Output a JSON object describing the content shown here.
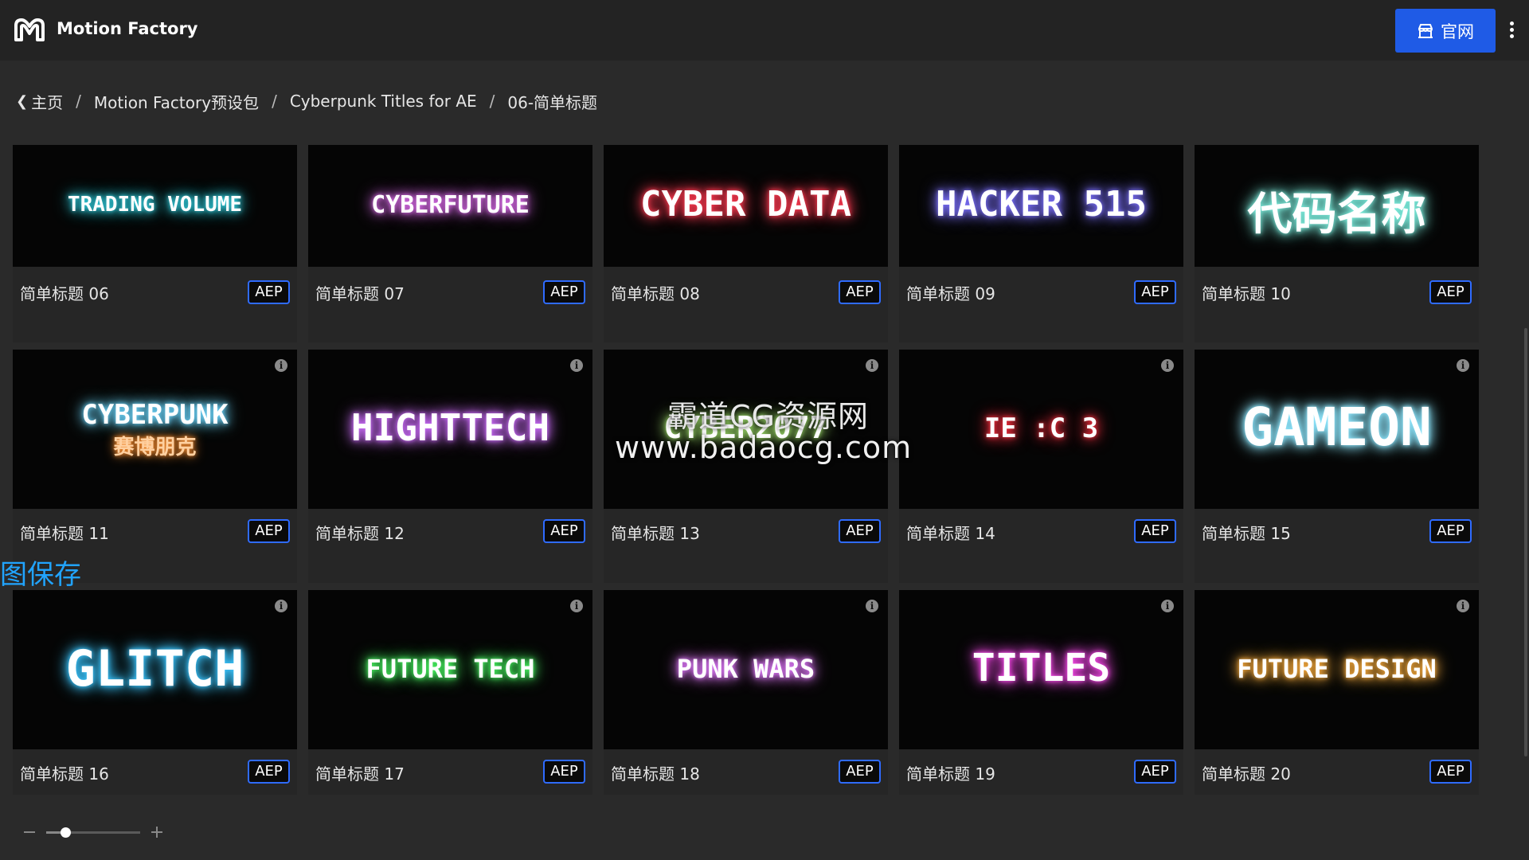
{
  "header": {
    "app_title": "Motion Factory",
    "official_button_label": "官网",
    "accent_color": "#1f5be6"
  },
  "breadcrumb": [
    {
      "label": "主页"
    },
    {
      "label": "Motion Factory预设包"
    },
    {
      "label": "Cyberpunk Titles for AE"
    },
    {
      "label": "06-简单标题"
    }
  ],
  "cards": [
    {
      "title": "简单标题 06",
      "badge": "AEP",
      "thumb_text": "TRADING VOLUME",
      "glow": "#35d6e6"
    },
    {
      "title": "简单标题 07",
      "badge": "AEP",
      "thumb_text": "CYBERFUTURE",
      "glow": "#e070f0"
    },
    {
      "title": "简单标题 08",
      "badge": "AEP",
      "thumb_text": "CYBER DATA",
      "glow": "#ff3b52"
    },
    {
      "title": "简单标题 09",
      "badge": "AEP",
      "thumb_text": "HACKER 515",
      "glow": "#7e73ff"
    },
    {
      "title": "简单标题 10",
      "badge": "AEP",
      "thumb_text": "代码名称",
      "glow": "#7ff0e0"
    },
    {
      "title": "简单标题 11",
      "badge": "AEP",
      "thumb_text": "CYBERPUNK",
      "thumb_text2": "赛博朋克",
      "glow": "#6fd8ff",
      "glow2": "#ff9030"
    },
    {
      "title": "简单标题 12",
      "badge": "AEP",
      "thumb_text": "HIGHTTECH",
      "glow": "#d070ff"
    },
    {
      "title": "简单标题 13",
      "badge": "AEP",
      "thumb_text": "CYBER2077",
      "glow": "#9bd86a"
    },
    {
      "title": "简单标题 14",
      "badge": "AEP",
      "thumb_text": "IE :C 3",
      "glow": "#ff3040"
    },
    {
      "title": "简单标题 15",
      "badge": "AEP",
      "thumb_text": "GAMEON",
      "glow": "#8fe8ff"
    },
    {
      "title": "简单标题 16",
      "badge": "AEP",
      "thumb_text": "GLITCH",
      "glow": "#3cc6ff"
    },
    {
      "title": "简单标题 17",
      "badge": "AEP",
      "thumb_text": "FUTURE TECH",
      "glow": "#4cff66"
    },
    {
      "title": "简单标题 18",
      "badge": "AEP",
      "thumb_text": "PUNK WARS",
      "glow": "#e37cff"
    },
    {
      "title": "简单标题 19",
      "badge": "AEP",
      "thumb_text": "TITLES",
      "glow": "#ff4cf0"
    },
    {
      "title": "简单标题 20",
      "badge": "AEP",
      "thumb_text": "FUTURE DESIGN",
      "glow": "#ffb040"
    }
  ],
  "watermark": {
    "cn_text": "霸道CG资源网",
    "url_text": "www.badaocg.com"
  },
  "save_overlay_label": "图保存",
  "zoom": {
    "level": 0.2
  }
}
